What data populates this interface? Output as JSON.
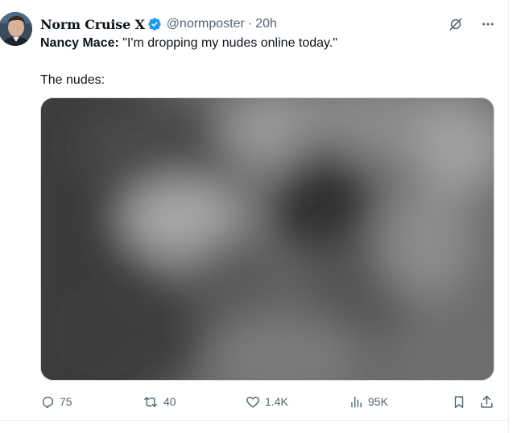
{
  "tweet": {
    "author_name": "Norm Cruise X",
    "handle": "@normposter",
    "separator": "·",
    "time": "20h",
    "text_bold": "Nancy Mace:",
    "text_quote": " \"I'm dropping my nudes online today.\"",
    "text_line2": "The nudes:"
  },
  "actions": {
    "replies": "75",
    "reposts": "40",
    "likes": "1.4K",
    "views": "95K"
  },
  "colors": {
    "verified": "#1d9bf0",
    "muted": "#536471",
    "text": "#0f1419"
  },
  "icons": [
    "verified-icon",
    "grok-icon",
    "more-icon",
    "reply-icon",
    "repost-icon",
    "like-icon",
    "views-icon",
    "bookmark-icon",
    "share-icon"
  ]
}
